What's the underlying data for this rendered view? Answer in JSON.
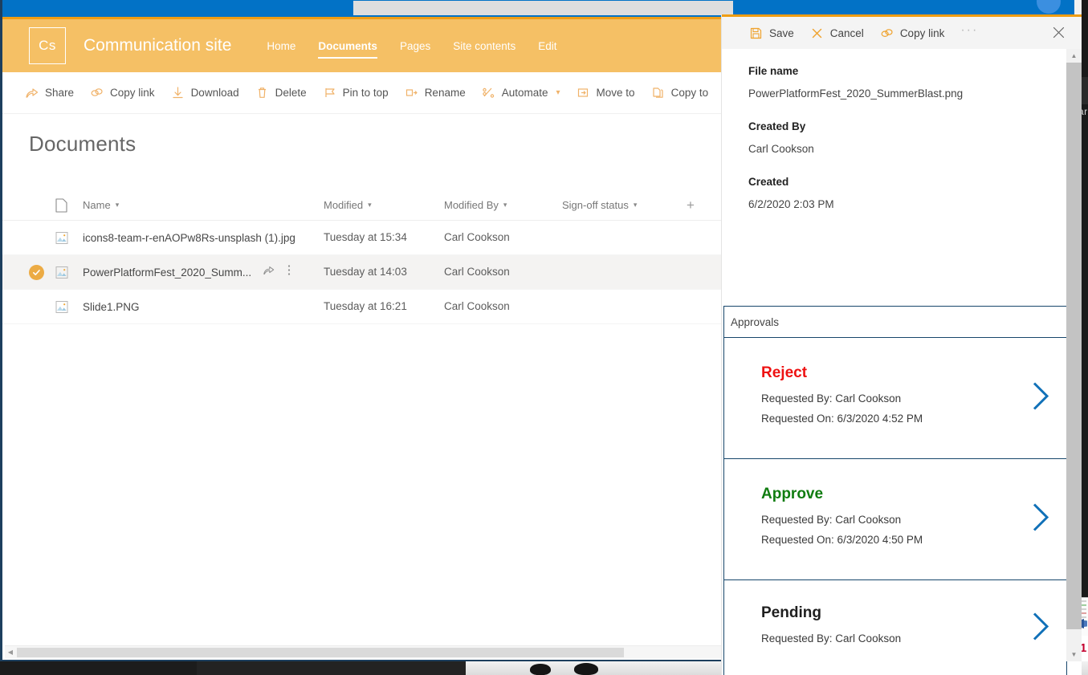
{
  "suitebar": {
    "search_placeholder": "",
    "avatar": "user-avatar"
  },
  "site_header": {
    "logo_text": "Cs",
    "title": "Communication site",
    "nav": [
      {
        "label": "Home",
        "active": false
      },
      {
        "label": "Documents",
        "active": true
      },
      {
        "label": "Pages",
        "active": false
      },
      {
        "label": "Site contents",
        "active": false
      },
      {
        "label": "Edit",
        "active": false
      }
    ]
  },
  "command_bar": {
    "items": [
      {
        "label": "Share",
        "icon": "share-icon",
        "chevron": false
      },
      {
        "label": "Copy link",
        "icon": "link-icon",
        "chevron": false
      },
      {
        "label": "Download",
        "icon": "download-icon",
        "chevron": false
      },
      {
        "label": "Delete",
        "icon": "trash-icon",
        "chevron": false
      },
      {
        "label": "Pin to top",
        "icon": "pin-icon",
        "chevron": false
      },
      {
        "label": "Rename",
        "icon": "rename-icon",
        "chevron": false
      },
      {
        "label": "Automate",
        "icon": "automate-icon",
        "chevron": true
      },
      {
        "label": "Move to",
        "icon": "move-to-icon",
        "chevron": false
      },
      {
        "label": "Copy to",
        "icon": "copy-to-icon",
        "chevron": false
      }
    ],
    "overflow_label": "···"
  },
  "page": {
    "title": "Documents"
  },
  "list": {
    "columns": [
      {
        "label": "Name",
        "sortable": true
      },
      {
        "label": "Modified",
        "sortable": true
      },
      {
        "label": "Modified By",
        "sortable": true
      },
      {
        "label": "Sign-off status",
        "sortable": true
      }
    ],
    "add_column_label": "+",
    "rows": [
      {
        "name": "icons8-team-r-enAOPw8Rs-unsplash (1).jpg",
        "modified": "Tuesday at 15:34",
        "modified_by": "Carl Cookson",
        "sign_off_status": "",
        "selected": false
      },
      {
        "name": "PowerPlatformFest_2020_Summ...",
        "modified": "Tuesday at 14:03",
        "modified_by": "Carl Cookson",
        "sign_off_status": "",
        "selected": true
      },
      {
        "name": "Slide1.PNG",
        "modified": "Tuesday at 16:21",
        "modified_by": "Carl Cookson",
        "sign_off_status": "",
        "selected": false
      }
    ]
  },
  "panel": {
    "commands": [
      {
        "label": "Save",
        "icon": "save-icon"
      },
      {
        "label": "Cancel",
        "icon": "cancel-icon"
      },
      {
        "label": "Copy link",
        "icon": "link-icon"
      }
    ],
    "overflow_label": "···",
    "close_label": "Close",
    "properties": [
      {
        "label": "File name",
        "value": "PowerPlatformFest_2020_SummerBlast.png"
      },
      {
        "label": "Created By",
        "value": "Carl Cookson"
      },
      {
        "label": "Created",
        "value": "6/2/2020 2:03 PM"
      }
    ],
    "approvals": {
      "section_title": "Approvals",
      "colors": {
        "reject": "#ee1111",
        "approve": "#107c10",
        "pending": "#1f1f1f",
        "chevron": "#1171b8",
        "border": "#17466b"
      },
      "cards": [
        {
          "status": "Reject",
          "status_color": "#ee1111",
          "requested_by": "Requested By: Carl Cookson",
          "requested_on": "Requested On: 6/3/2020 4:52 PM"
        },
        {
          "status": "Approve",
          "status_color": "#107c10",
          "requested_by": "Requested By: Carl Cookson",
          "requested_on": "Requested On: 6/3/2020 4:50 PM"
        },
        {
          "status": "Pending",
          "status_color": "#1f1f1f",
          "requested_by": "Requested By: Carl Cookson",
          "requested_on": ""
        }
      ]
    }
  },
  "background": {
    "right_label": "ar",
    "right_badge": "1"
  }
}
